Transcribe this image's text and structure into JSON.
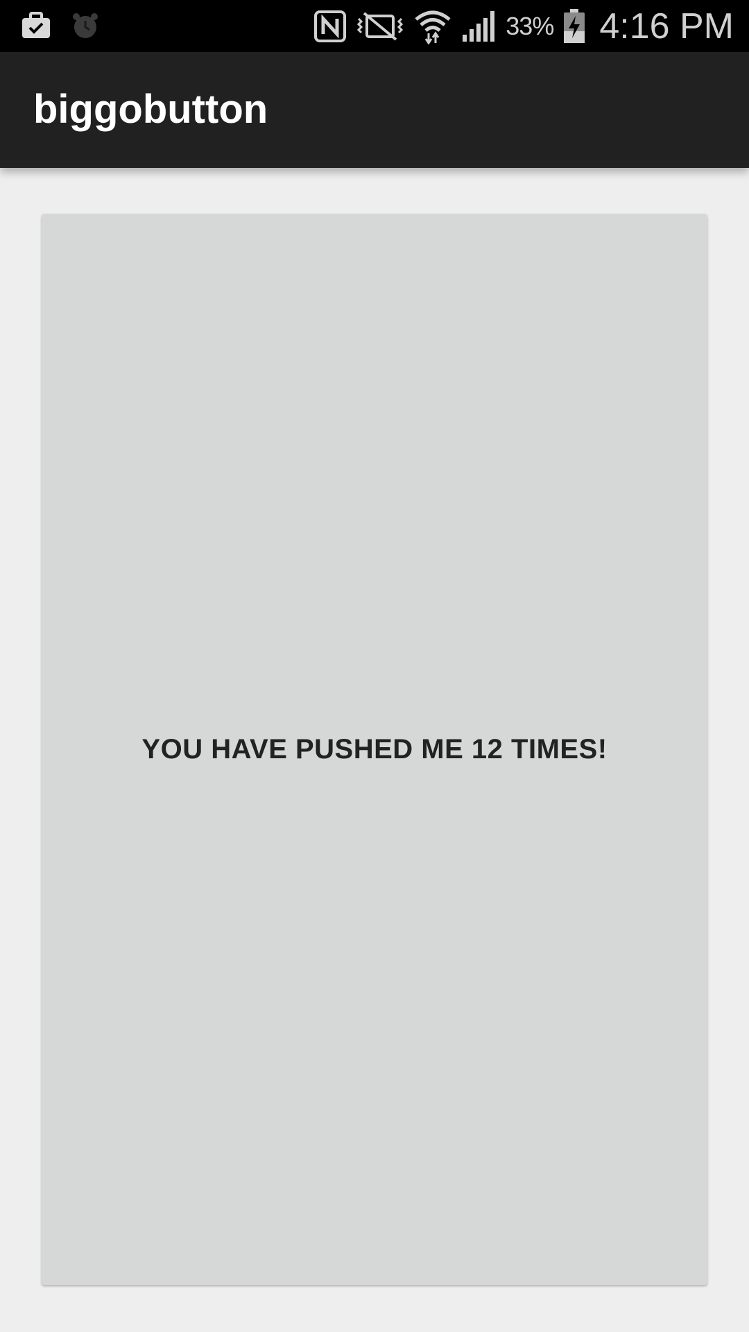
{
  "status_bar": {
    "left_icons": [
      "work-briefcase-icon",
      "alarm-clock-icon"
    ],
    "right_icons": [
      "nfc-icon",
      "vibrate-mute-icon",
      "wifi-icon",
      "cell-signal-icon"
    ],
    "battery_percent": "33%",
    "battery_icon": "battery-charging-icon",
    "time": "4:16 PM"
  },
  "app_bar": {
    "title": "biggobutton"
  },
  "main": {
    "button_label": "YOU HAVE PUSHED ME 12 TIMES!"
  },
  "colors": {
    "status_bar_bg": "#000000",
    "app_bar_bg": "#212121",
    "content_bg": "#eeeeee",
    "button_bg": "#d6d7d7",
    "button_text": "#222222"
  }
}
